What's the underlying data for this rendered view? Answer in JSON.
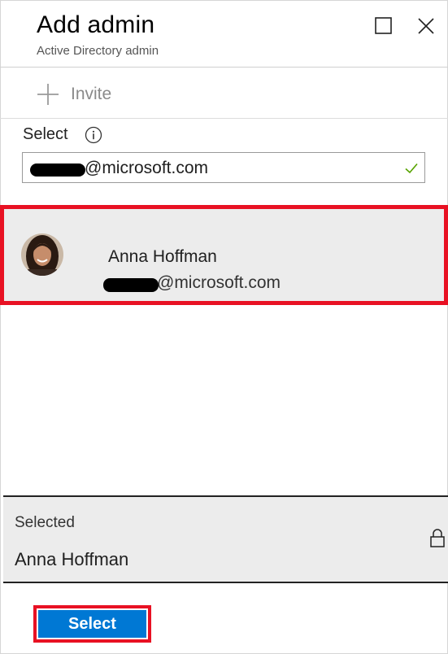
{
  "header": {
    "title": "Add admin",
    "subtitle": "Active Directory admin"
  },
  "toolbar": {
    "invite_label": "Invite"
  },
  "select": {
    "label": "Select",
    "input_value": "@microsoft.com"
  },
  "results": [
    {
      "name": "Anna Hoffman",
      "email": "@microsoft.com"
    }
  ],
  "selected": {
    "heading": "Selected",
    "name": "Anna Hoffman"
  },
  "actions": {
    "select_button": "Select"
  },
  "icons": {
    "maximize": "maximize-icon",
    "close": "close-icon",
    "invite": "plus-icon",
    "info": "info-icon",
    "valid": "checkmark-icon",
    "lock": "lock-icon"
  },
  "colors": {
    "accent": "#0078d4",
    "highlight_border": "#e81123",
    "valid_check": "#57a300",
    "selected_bg": "#ececec"
  }
}
